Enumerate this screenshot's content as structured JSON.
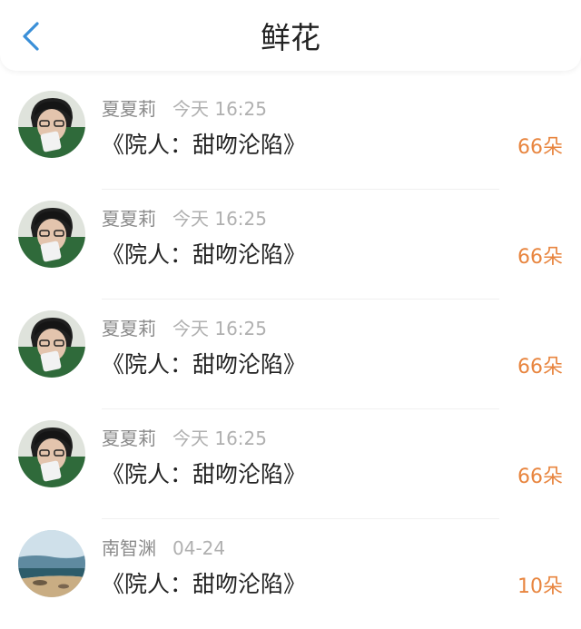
{
  "header": {
    "title": "鲜花",
    "back_icon": "chevron-left-icon",
    "accent": "#3a8fd8"
  },
  "colors": {
    "amount": "#e8853f"
  },
  "items": [
    {
      "name": "夏夏莉",
      "time": "今天 16:25",
      "book": "《院人：甜吻沦陷》",
      "amount": "66朵",
      "avatar": "person-avatar"
    },
    {
      "name": "夏夏莉",
      "time": "今天 16:25",
      "book": "《院人：甜吻沦陷》",
      "amount": "66朵",
      "avatar": "person-avatar"
    },
    {
      "name": "夏夏莉",
      "time": "今天 16:25",
      "book": "《院人：甜吻沦陷》",
      "amount": "66朵",
      "avatar": "person-avatar"
    },
    {
      "name": "夏夏莉",
      "time": "今天 16:25",
      "book": "《院人：甜吻沦陷》",
      "amount": "66朵",
      "avatar": "person-avatar"
    },
    {
      "name": "南智渊",
      "time": "04-24",
      "book": "《院人：甜吻沦陷》",
      "amount": "10朵",
      "avatar": "beach-avatar"
    }
  ]
}
